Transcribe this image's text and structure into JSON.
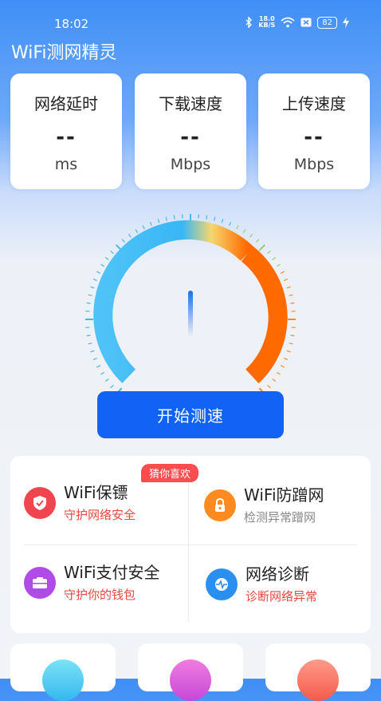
{
  "status_bar": {
    "time": "18:02",
    "net_speed_value": "18.0",
    "net_speed_unit": "KB/S",
    "battery": "82"
  },
  "app": {
    "title": "WiFi测网精灵"
  },
  "metrics": [
    {
      "title": "网络延时",
      "value": "--",
      "unit": "ms"
    },
    {
      "title": "下载速度",
      "value": "--",
      "unit": "Mbps"
    },
    {
      "title": "上传速度",
      "value": "--",
      "unit": "Mbps"
    }
  ],
  "gauge": {
    "needle_value": 0
  },
  "start_button": {
    "label": "开始测速"
  },
  "tools": [
    {
      "title": "WiFi保镖",
      "subtitle": "守护网络安全",
      "badge": "猜你喜欢",
      "icon": "shield-icon",
      "color": "#f0454f",
      "subtitle_color": "#e5483f"
    },
    {
      "title": "WiFi防蹭网",
      "subtitle": "检测异常蹭网",
      "icon": "lock-icon",
      "color": "#ff8a1f",
      "subtitle_color": "#888888"
    },
    {
      "title": "WiFi支付安全",
      "subtitle": "守护你的钱包",
      "icon": "wallet-icon",
      "color": "#b14be8",
      "subtitle_color": "#e5483f"
    },
    {
      "title": "网络诊断",
      "subtitle": "诊断网络异常",
      "icon": "pulse-icon",
      "color": "#2a8fef",
      "subtitle_color": "#e5483f"
    }
  ],
  "colors": {
    "accent": "#1162f5",
    "gauge_cool": "#38b6f5",
    "gauge_warm": "#ff6a00"
  }
}
